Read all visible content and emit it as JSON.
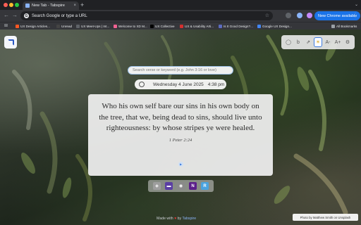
{
  "browser": {
    "tab_title": "New Tab - Tabspire",
    "tab_close": "×",
    "new_tab": "+",
    "window_controls": "⌄",
    "address_placeholder": "Search Google or type a URL",
    "google_glyph": "G",
    "update_label": "New Chrome available",
    "menu_glyph": "⋮",
    "nav": {
      "back": "←",
      "forward": "→",
      "reload": "↻",
      "star": "☆"
    }
  },
  "bookmarks": {
    "apps_glyph": "⊞",
    "items": [
      {
        "label": "UX Design Articles...",
        "color": "#ff5722"
      },
      {
        "label": "Unread",
        "color": "#444"
      },
      {
        "label": "UX Meet-Ups | Int...",
        "color": "#5f6368"
      },
      {
        "label": "Welcome to XD M...",
        "color": "#f06292"
      },
      {
        "label": "UX Collective",
        "color": "#000"
      },
      {
        "label": "UX & Usability Arti...",
        "color": "#d32f2f"
      },
      {
        "label": "Is It Good Design?...",
        "color": "#5c6bc0"
      },
      {
        "label": "Google UX Design...",
        "color": "#4285f4"
      }
    ],
    "all_label": "All Bookmarks"
  },
  "controls": {
    "buttons": [
      {
        "glyph": "◯",
        "name": "refresh-verse-button"
      },
      {
        "glyph": "b",
        "name": "bible-version-button"
      },
      {
        "glyph": "⇗",
        "name": "share-button"
      },
      {
        "glyph": "☀",
        "name": "theme-toggle-button",
        "active": true
      },
      {
        "glyph": "A-",
        "name": "decrease-font-button"
      },
      {
        "glyph": "A+",
        "name": "increase-font-button"
      },
      {
        "glyph": "⚙",
        "name": "settings-button"
      }
    ]
  },
  "search": {
    "placeholder": "Search verse or keyword (e.g. John 3:16 or love)"
  },
  "datetime": {
    "date": "Wednesday 4 June 2025",
    "time": "4:38 pm"
  },
  "verse": {
    "text": "Who his own self bare our sins in his own body on the tree, that we, being dead to sins, should live unto righteousness: by whose stripes ye were healed.",
    "reference": "1 Peter 2:24",
    "play_glyph": "▶"
  },
  "dock": [
    {
      "name": "dock-app-1",
      "glyph": "◈",
      "color": "#888"
    },
    {
      "name": "dock-app-2",
      "glyph": "▬",
      "color": "#5b3fa3"
    },
    {
      "name": "dock-app-3",
      "glyph": "◉",
      "color": "#8a8a8a"
    },
    {
      "name": "dock-app-4",
      "glyph": "N",
      "color": "#5b1f8a"
    },
    {
      "name": "dock-app-5",
      "glyph": "R",
      "color": "#4aa3df"
    }
  ],
  "footer": {
    "made_with": "Made with",
    "heart": "♥",
    "by": "by",
    "author": "Tabspire"
  },
  "photo_credit": "Photo by Matthew Smith on Unsplash"
}
